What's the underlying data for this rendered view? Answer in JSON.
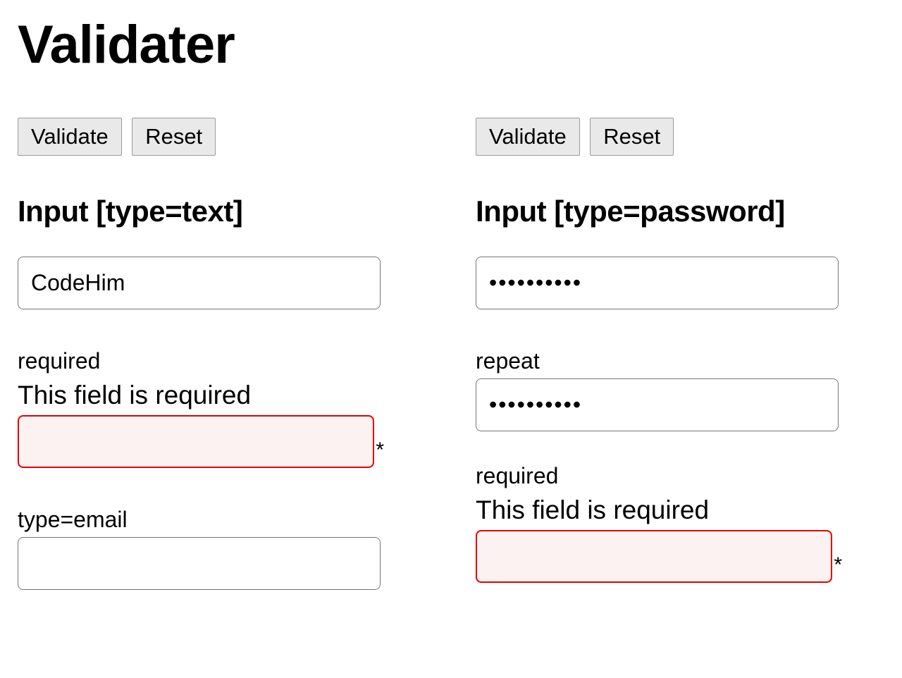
{
  "title": "Validater",
  "left": {
    "buttons": {
      "validate": "Validate",
      "reset": "Reset"
    },
    "heading": "Input [type=text]",
    "field1": {
      "value": "CodeHim"
    },
    "field2": {
      "label": "required",
      "error": "This field is required",
      "value": "",
      "asterisk": "*"
    },
    "field3": {
      "label": "type=email",
      "value": ""
    }
  },
  "right": {
    "buttons": {
      "validate": "Validate",
      "reset": "Reset"
    },
    "heading": "Input [type=password]",
    "field1": {
      "value": "••••••••••"
    },
    "field2": {
      "label": "repeat",
      "value": "••••••••••"
    },
    "field3": {
      "label": "required",
      "error": "This field is required",
      "value": "",
      "asterisk": "*"
    }
  }
}
